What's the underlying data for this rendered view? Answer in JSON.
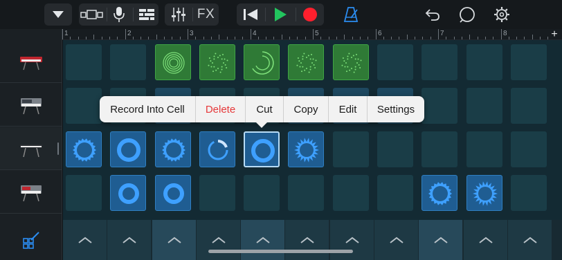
{
  "toolbar": {
    "browser_icon": "triangle-down-icon",
    "tracks_view_icon": "tracks-view-icon",
    "mic_icon": "microphone-icon",
    "live_loops_icon": "live-loops-grid-icon",
    "mixer_icon": "mixer-sliders-icon",
    "fx_label": "FX",
    "rewind_icon": "go-to-start-icon",
    "play_icon": "play-icon",
    "record_icon": "record-icon",
    "metronome_icon": "metronome-icon",
    "undo_icon": "undo-icon",
    "loop_browser_icon": "loop-icon",
    "settings_icon": "gear-icon",
    "accent_color": "#2b8cf0",
    "play_color": "#22c55e",
    "record_color": "#ff1f2d"
  },
  "ruler": {
    "bars": [
      "1",
      "2",
      "3",
      "4",
      "5",
      "6",
      "7",
      "8"
    ],
    "add_icon": "+"
  },
  "tracks": [
    {
      "name": "keyboard-red-synth",
      "icon": "red-keyboard-icon"
    },
    {
      "name": "synth-module",
      "icon": "synth-keyboard-icon"
    },
    {
      "name": "keyboard-white",
      "icon": "white-keyboard-icon"
    },
    {
      "name": "synth-pad",
      "icon": "synth-keyboard-icon"
    }
  ],
  "edit_icon": "cell-edit-icon",
  "context_menu": {
    "items": [
      {
        "label": "Record Into Cell",
        "danger": false
      },
      {
        "label": "Delete",
        "danger": true
      },
      {
        "label": "Cut",
        "danger": false
      },
      {
        "label": "Copy",
        "danger": false
      },
      {
        "label": "Edit",
        "danger": false
      },
      {
        "label": "Settings",
        "danger": false
      }
    ]
  },
  "colors": {
    "cell_empty": "#1a3d47",
    "cell_green": "#2f7a36",
    "cell_blue": "#1f5d92"
  }
}
